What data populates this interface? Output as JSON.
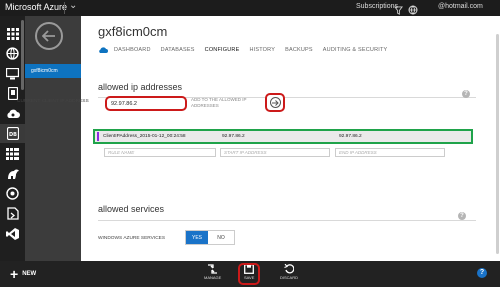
{
  "topbar": {
    "brand": "Microsoft Azure",
    "subscriptions": "Subscriptions",
    "account": "@hotmail.com"
  },
  "sidebar": {
    "items": [
      {
        "icon": "all-items-icon"
      },
      {
        "icon": "websites-icon"
      },
      {
        "icon": "virtual-machines-icon"
      },
      {
        "icon": "mobile-services-icon"
      },
      {
        "icon": "cloud-services-icon"
      },
      {
        "icon": "sql-databases-icon"
      },
      {
        "icon": "storage-icon"
      },
      {
        "icon": "hdinsight-icon"
      },
      {
        "icon": "media-services-icon"
      },
      {
        "icon": "service-bus-icon"
      },
      {
        "icon": "visual-studio-icon"
      }
    ]
  },
  "subnav": {
    "item": "gxf8icm0cm"
  },
  "main": {
    "title": "gxf8icm0cm",
    "tabs": [
      "DASHBOARD",
      "DATABASES",
      "CONFIGURE",
      "HISTORY",
      "BACKUPS",
      "AUDITING & SECURITY"
    ],
    "allowed_ip": {
      "title": "allowed ip addresses",
      "current_label": "CURRENT CLIENT IP ADDRESS",
      "current_value": "92.97.86.2",
      "add_text": "ADD TO THE ALLOWED IP ADDRESSES",
      "rule": {
        "name": "ClientIPAddress_2015-01-12_00:24:58",
        "start": "92.97.86.2",
        "end": "92.97.86.2"
      },
      "placeholders": {
        "rule_name": "RULE NAME",
        "start_ip": "START IP ADDRESS",
        "end_ip": "END IP ADDRESS"
      }
    },
    "allowed_services": {
      "title": "allowed services",
      "ws_label": "WINDOWS AZURE SERVICES",
      "yes": "YES",
      "no": "NO",
      "selected": "YES"
    }
  },
  "bottombar": {
    "new_label": "NEW",
    "manage": "MANAGE",
    "save": "SAVE",
    "discard": "DISCARD",
    "help": "?"
  },
  "colors": {
    "accent_blue": "#1a73c8",
    "highlight_red": "#cc1a1a",
    "highlight_green": "#1fa34a",
    "rule_bar": "#8a2be2"
  }
}
